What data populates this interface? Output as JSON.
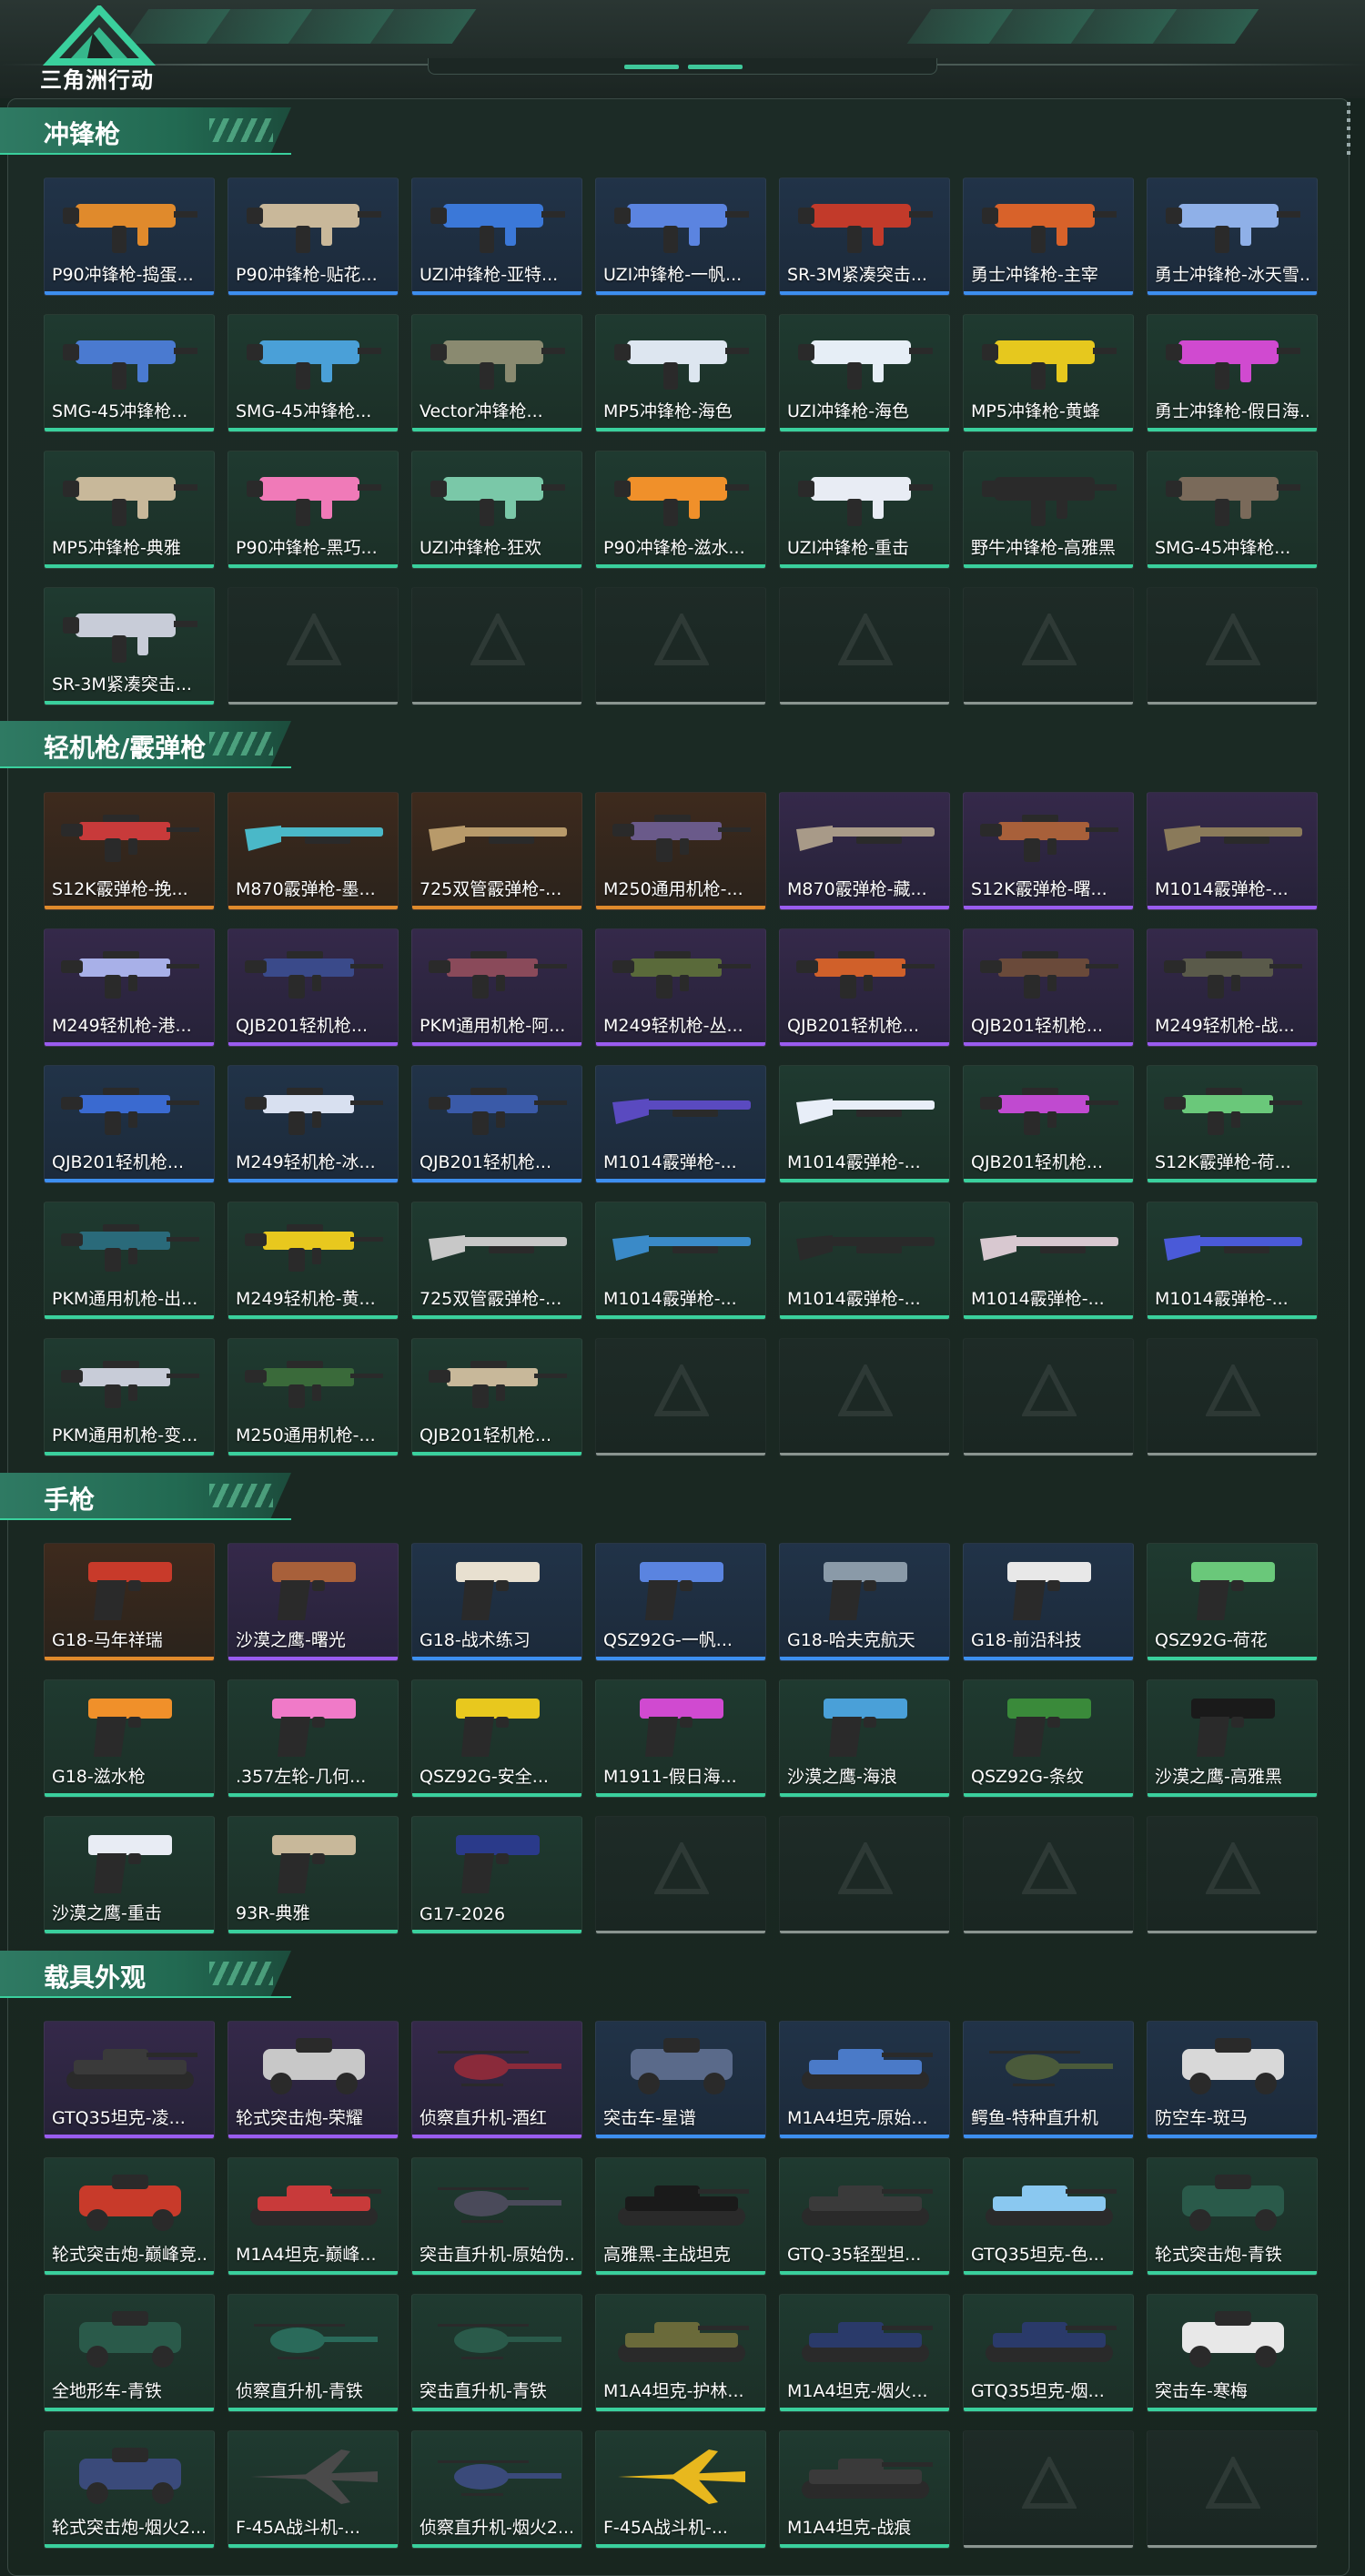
{
  "game_logo_text": "三角洲行动",
  "sections": [
    {
      "title": "冲锋枪",
      "items": [
        {
          "name": "P90冲锋枪-捣蛋...",
          "quality": "blue",
          "kind": "smg",
          "color": "#e08a2c"
        },
        {
          "name": "P90冲锋枪-贴花...",
          "quality": "blue",
          "kind": "smg",
          "color": "#c9b89a"
        },
        {
          "name": "UZI冲锋枪-亚特...",
          "quality": "blue",
          "kind": "smg",
          "color": "#3b78d8"
        },
        {
          "name": "UZI冲锋枪-一帆...",
          "quality": "blue",
          "kind": "smg",
          "color": "#5b84e0"
        },
        {
          "name": "SR-3M紧凑突击...",
          "quality": "blue",
          "kind": "smg",
          "color": "#c23a2a"
        },
        {
          "name": "勇士冲锋枪-主宰",
          "quality": "blue",
          "kind": "smg",
          "color": "#d8622a"
        },
        {
          "name": "勇士冲锋枪-冰天雪...",
          "quality": "blue",
          "kind": "smg",
          "color": "#8fb0e8"
        },
        {
          "name": "SMG-45冲锋枪...",
          "quality": "green",
          "kind": "smg",
          "color": "#4a7ad0"
        },
        {
          "name": "SMG-45冲锋枪...",
          "quality": "green",
          "kind": "smg",
          "color": "#4aa0d8"
        },
        {
          "name": "Vector冲锋枪...",
          "quality": "green",
          "kind": "smg",
          "color": "#8a8a70"
        },
        {
          "name": "MP5冲锋枪-海色",
          "quality": "green",
          "kind": "smg",
          "color": "#dde6f0"
        },
        {
          "name": "UZI冲锋枪-海色",
          "quality": "green",
          "kind": "smg",
          "color": "#e6eef6"
        },
        {
          "name": "MP5冲锋枪-黄蜂",
          "quality": "green",
          "kind": "smg",
          "color": "#e6c81e"
        },
        {
          "name": "勇士冲锋枪-假日海...",
          "quality": "green",
          "kind": "smg",
          "color": "#d04ad0"
        },
        {
          "name": "MP5冲锋枪-典雅",
          "quality": "green",
          "kind": "smg",
          "color": "#c8b89a"
        },
        {
          "name": "P90冲锋枪-黑巧...",
          "quality": "green",
          "kind": "smg",
          "color": "#f07ab8"
        },
        {
          "name": "UZI冲锋枪-狂欢",
          "quality": "green",
          "kind": "smg",
          "color": "#7ac8a8"
        },
        {
          "name": "P90冲锋枪-滋水...",
          "quality": "green",
          "kind": "smg",
          "color": "#f0902a"
        },
        {
          "name": "UZI冲锋枪-重击",
          "quality": "green",
          "kind": "smg",
          "color": "#e8ecf4"
        },
        {
          "name": "野牛冲锋枪-高雅黑",
          "quality": "green",
          "kind": "smg",
          "color": "#2a2a2a"
        },
        {
          "name": "SMG-45冲锋枪...",
          "quality": "green",
          "kind": "smg",
          "color": "#7a6a5a"
        },
        {
          "name": "SR-3M紧凑突击...",
          "quality": "green",
          "kind": "smg",
          "color": "#c8ccd8"
        },
        {
          "empty": true
        },
        {
          "empty": true
        },
        {
          "empty": true
        },
        {
          "empty": true
        },
        {
          "empty": true
        },
        {
          "empty": true
        }
      ]
    },
    {
      "title": "轻机枪/霰弹枪",
      "items": [
        {
          "name": "S12K霰弹枪-挽...",
          "quality": "orange",
          "kind": "rifle",
          "color": "#c83a3a"
        },
        {
          "name": "M870霰弹枪-墨...",
          "quality": "orange",
          "kind": "shotgun",
          "color": "#4ab8c8"
        },
        {
          "name": "725双管霰弹枪-...",
          "quality": "orange",
          "kind": "shotgun",
          "color": "#b89a6a"
        },
        {
          "name": "M250通用机枪-...",
          "quality": "orange",
          "kind": "rifle",
          "color": "#6a5a8a"
        },
        {
          "name": "M870霰弹枪-藏...",
          "quality": "purple",
          "kind": "shotgun",
          "color": "#a89a88"
        },
        {
          "name": "S12K霰弹枪-曙...",
          "quality": "purple",
          "kind": "rifle",
          "color": "#a8603a"
        },
        {
          "name": "M1014霰弹枪-...",
          "quality": "purple",
          "kind": "shotgun",
          "color": "#8a7a5a"
        },
        {
          "name": "M249轻机枪-港...",
          "quality": "purple",
          "kind": "rifle",
          "color": "#a8b0e8"
        },
        {
          "name": "QJB201轻机枪...",
          "quality": "purple",
          "kind": "rifle",
          "color": "#3a4a8a"
        },
        {
          "name": "PKM通用机枪-阿...",
          "quality": "purple",
          "kind": "rifle",
          "color": "#8a4a5a"
        },
        {
          "name": "M249轻机枪-丛...",
          "quality": "purple",
          "kind": "rifle",
          "color": "#5a6a3a"
        },
        {
          "name": "QJB201轻机枪...",
          "quality": "purple",
          "kind": "rifle",
          "color": "#d0602a"
        },
        {
          "name": "QJB201轻机枪...",
          "quality": "purple",
          "kind": "rifle",
          "color": "#6a4a3a"
        },
        {
          "name": "M249轻机枪-战...",
          "quality": "purple",
          "kind": "rifle",
          "color": "#5a5a4a"
        },
        {
          "name": "QJB201轻机枪...",
          "quality": "blue",
          "kind": "rifle",
          "color": "#3a6ad0"
        },
        {
          "name": "M249轻机枪-冰...",
          "quality": "blue",
          "kind": "rifle",
          "color": "#d8e0f0"
        },
        {
          "name": "QJB201轻机枪...",
          "quality": "blue",
          "kind": "rifle",
          "color": "#3a5aa8"
        },
        {
          "name": "M1014霰弹枪-...",
          "quality": "blue",
          "kind": "shotgun",
          "color": "#5a4ac0"
        },
        {
          "name": "M1014霰弹枪-...",
          "quality": "green",
          "kind": "shotgun",
          "color": "#e8eef8"
        },
        {
          "name": "QJB201轻机枪...",
          "quality": "green",
          "kind": "rifle",
          "color": "#c04ad0"
        },
        {
          "name": "S12K霰弹枪-荷...",
          "quality": "green",
          "kind": "rifle",
          "color": "#6ac87a"
        },
        {
          "name": "PKM通用机枪-出...",
          "quality": "green",
          "kind": "rifle",
          "color": "#2a6a7a"
        },
        {
          "name": "M249轻机枪-黄...",
          "quality": "green",
          "kind": "rifle",
          "color": "#e8c81e"
        },
        {
          "name": "725双管霰弹枪-...",
          "quality": "green",
          "kind": "shotgun",
          "color": "#c8c8c8"
        },
        {
          "name": "M1014霰弹枪-...",
          "quality": "green",
          "kind": "shotgun",
          "color": "#3a8ac8"
        },
        {
          "name": "M1014霰弹枪-...",
          "quality": "green",
          "kind": "shotgun",
          "color": "#2a2a2a"
        },
        {
          "name": "M1014霰弹枪-...",
          "quality": "green",
          "kind": "shotgun",
          "color": "#d8c8d0"
        },
        {
          "name": "M1014霰弹枪-...",
          "quality": "green",
          "kind": "shotgun",
          "color": "#4a5ad8"
        },
        {
          "name": "PKM通用机枪-变...",
          "quality": "green",
          "kind": "rifle",
          "color": "#c8ccd8"
        },
        {
          "name": "M250通用机枪-...",
          "quality": "green",
          "kind": "rifle",
          "color": "#3a6a3a"
        },
        {
          "name": "QJB201轻机枪...",
          "quality": "green",
          "kind": "rifle",
          "color": "#c8b89a"
        },
        {
          "empty": true
        },
        {
          "empty": true
        },
        {
          "empty": true
        },
        {
          "empty": true
        }
      ]
    },
    {
      "title": "手枪",
      "items": [
        {
          "name": "G18-马年祥瑞",
          "quality": "orange",
          "kind": "pistol",
          "color": "#c83a2a"
        },
        {
          "name": "沙漠之鹰-曙光",
          "quality": "purple",
          "kind": "pistol",
          "color": "#a8603a"
        },
        {
          "name": "G18-战术练习",
          "quality": "blue",
          "kind": "pistol",
          "color": "#e8e0d0"
        },
        {
          "name": "QSZ92G-一帆...",
          "quality": "blue",
          "kind": "pistol",
          "color": "#5a84e0"
        },
        {
          "name": "G18-哈夫克航天",
          "quality": "blue",
          "kind": "pistol",
          "color": "#8a9aa8"
        },
        {
          "name": "G18-前沿科技",
          "quality": "blue",
          "kind": "pistol",
          "color": "#e8e8e8"
        },
        {
          "name": "QSZ92G-荷花",
          "quality": "green",
          "kind": "pistol",
          "color": "#6ac87a"
        },
        {
          "name": "G18-滋水枪",
          "quality": "green",
          "kind": "pistol",
          "color": "#f0902a"
        },
        {
          "name": ".357左轮-几何...",
          "quality": "green",
          "kind": "pistol",
          "color": "#f07ac8"
        },
        {
          "name": "QSZ92G-安全...",
          "quality": "green",
          "kind": "pistol",
          "color": "#e8c81e"
        },
        {
          "name": "M1911-假日海...",
          "quality": "green",
          "kind": "pistol",
          "color": "#d04ad0"
        },
        {
          "name": "沙漠之鹰-海浪",
          "quality": "green",
          "kind": "pistol",
          "color": "#4aa0d8"
        },
        {
          "name": "QSZ92G-条纹",
          "quality": "green",
          "kind": "pistol",
          "color": "#3a8a3a"
        },
        {
          "name": "沙漠之鹰-高雅黑",
          "quality": "green",
          "kind": "pistol",
          "color": "#1a1a1a"
        },
        {
          "name": "沙漠之鹰-重击",
          "quality": "green",
          "kind": "pistol",
          "color": "#e8ecf4"
        },
        {
          "name": "93R-典雅",
          "quality": "green",
          "kind": "pistol",
          "color": "#c8b89a"
        },
        {
          "name": "G17-2026",
          "quality": "green",
          "kind": "pistol",
          "color": "#2a3a8a"
        },
        {
          "empty": true
        },
        {
          "empty": true
        },
        {
          "empty": true
        },
        {
          "empty": true
        }
      ]
    },
    {
      "title": "载具外观",
      "items": [
        {
          "name": "GTQ35坦克-凌...",
          "quality": "purple",
          "kind": "tank",
          "color": "#3a3a3a"
        },
        {
          "name": "轮式突击炮-荣耀",
          "quality": "purple",
          "kind": "car",
          "color": "#c8c8c8"
        },
        {
          "name": "侦察直升机-酒红",
          "quality": "purple",
          "kind": "heli",
          "color": "#8a2a3a"
        },
        {
          "name": "突击车-星谱",
          "quality": "blue",
          "kind": "car",
          "color": "#5a6a8a"
        },
        {
          "name": "M1A4坦克-原始...",
          "quality": "blue",
          "kind": "tank",
          "color": "#4a7ac8"
        },
        {
          "name": "鳄鱼-特种直升机",
          "quality": "blue",
          "kind": "heli",
          "color": "#4a5a3a"
        },
        {
          "name": "防空车-斑马",
          "quality": "blue",
          "kind": "car",
          "color": "#d8d8d8"
        },
        {
          "name": "轮式突击炮-巅峰竞...",
          "quality": "green",
          "kind": "car",
          "color": "#c83a2a"
        },
        {
          "name": "M1A4坦克-巅峰...",
          "quality": "green",
          "kind": "tank",
          "color": "#c83a3a"
        },
        {
          "name": "突击直升机-原始伪...",
          "quality": "green",
          "kind": "heli",
          "color": "#4a4a5a"
        },
        {
          "name": "高雅黑-主战坦克",
          "quality": "green",
          "kind": "tank",
          "color": "#1a1a1a"
        },
        {
          "name": "GTQ-35轻型坦...",
          "quality": "green",
          "kind": "tank",
          "color": "#3a3a3a"
        },
        {
          "name": "GTQ35坦克-色...",
          "quality": "green",
          "kind": "tank",
          "color": "#8ac8f0"
        },
        {
          "name": "轮式突击炮-青铁",
          "quality": "green",
          "kind": "car",
          "color": "#2a5a4a"
        },
        {
          "name": "全地形车-青铁",
          "quality": "green",
          "kind": "car",
          "color": "#2a5a4a"
        },
        {
          "name": "侦察直升机-青铁",
          "quality": "green",
          "kind": "heli",
          "color": "#2a6a5a"
        },
        {
          "name": "突击直升机-青铁",
          "quality": "green",
          "kind": "heli",
          "color": "#2a5a4a"
        },
        {
          "name": "M1A4坦克-护林...",
          "quality": "green",
          "kind": "tank",
          "color": "#6a6a3a"
        },
        {
          "name": "M1A4坦克-烟火...",
          "quality": "green",
          "kind": "tank",
          "color": "#2a3a6a"
        },
        {
          "name": "GTQ35坦克-烟...",
          "quality": "green",
          "kind": "tank",
          "color": "#2a3a6a"
        },
        {
          "name": "突击车-寒梅",
          "quality": "green",
          "kind": "car",
          "color": "#e8e8e8"
        },
        {
          "name": "轮式突击炮-烟火2...",
          "quality": "green",
          "kind": "car",
          "color": "#3a4a7a"
        },
        {
          "name": "F-45A战斗机-...",
          "quality": "green",
          "kind": "jet",
          "color": "#4a4a4a"
        },
        {
          "name": "侦察直升机-烟火2...",
          "quality": "green",
          "kind": "heli",
          "color": "#3a4a7a"
        },
        {
          "name": "F-45A战斗机-...",
          "quality": "green",
          "kind": "jet",
          "color": "#e8b81e"
        },
        {
          "name": "M1A4坦克-战痕",
          "quality": "green",
          "kind": "tank",
          "color": "#3a3a3a"
        },
        {
          "empty": true
        },
        {
          "empty": true
        }
      ]
    }
  ]
}
